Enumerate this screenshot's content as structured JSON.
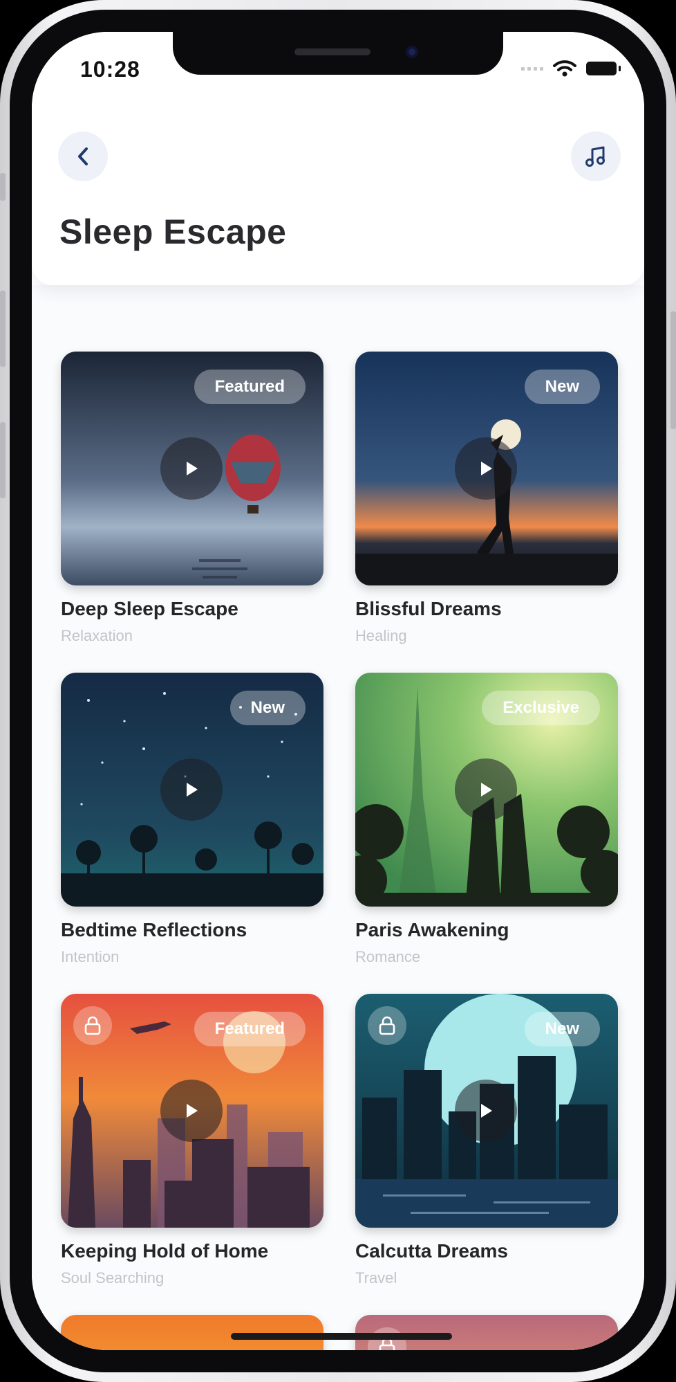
{
  "status_bar": {
    "time": "10:28"
  },
  "header": {
    "back_icon": "chevron-left-icon",
    "music_icon": "music-note-icon",
    "title": "Sleep Escape"
  },
  "cards": [
    {
      "title": "Deep Sleep Escape",
      "subtitle": "Relaxation",
      "badge": "Featured",
      "locked": false
    },
    {
      "title": "Blissful Dreams",
      "subtitle": "Healing",
      "badge": "New",
      "locked": false
    },
    {
      "title": "Bedtime Reflections",
      "subtitle": "Intention",
      "badge": "New",
      "locked": false
    },
    {
      "title": "Paris Awakening",
      "subtitle": "Romance",
      "badge": "Exclusive",
      "locked": false
    },
    {
      "title": "Keeping Hold of Home",
      "subtitle": "Soul Searching",
      "badge": "Featured",
      "locked": true
    },
    {
      "title": "Calcutta Dreams",
      "subtitle": "Travel",
      "badge": "New",
      "locked": true
    }
  ],
  "colors": {
    "accent": "#1f3a6b",
    "title": "#2a2a2e",
    "subtitle": "#c2c4c8"
  }
}
